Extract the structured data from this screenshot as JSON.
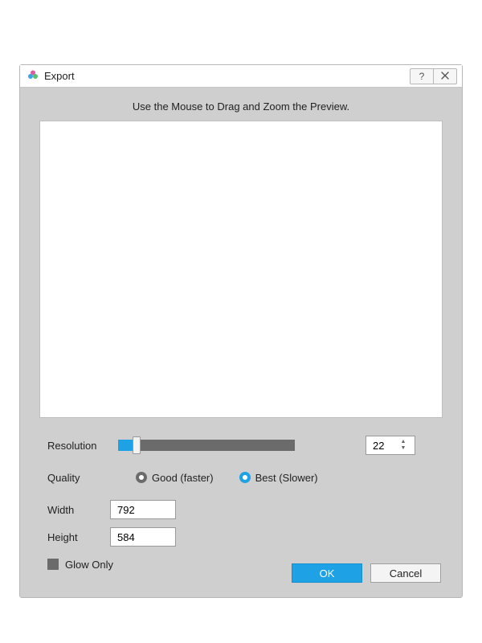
{
  "window": {
    "title": "Export"
  },
  "instruction": "Use the Mouse to Drag and Zoom the Preview.",
  "resolution": {
    "label": "Resolution",
    "value": "22"
  },
  "quality": {
    "label": "Quality",
    "options": {
      "good": "Good (faster)",
      "best": "Best (Slower)"
    },
    "selected": "best"
  },
  "dimensions": {
    "width_label": "Width",
    "width_value": "792",
    "height_label": "Height",
    "height_value": "584"
  },
  "glow_only_label": "Glow Only",
  "buttons": {
    "ok": "OK",
    "cancel": "Cancel"
  }
}
